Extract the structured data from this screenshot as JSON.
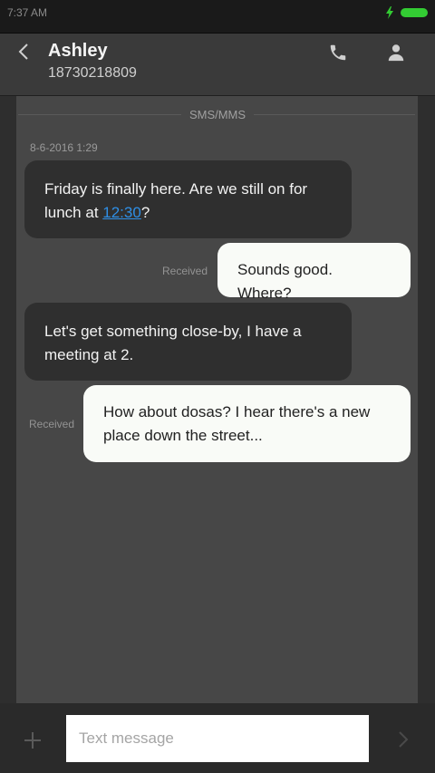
{
  "status_bar": {
    "time": "7:37 AM",
    "icons": [
      "charging-bolt-icon",
      "battery-icon"
    ],
    "battery_color": "#33cc33"
  },
  "header": {
    "contact_name": "Ashley",
    "contact_number": "18730218809",
    "icons": [
      "back-icon",
      "phone-icon",
      "person-icon"
    ]
  },
  "conversation": {
    "channel_label": "SMS/MMS",
    "date": "8-6-2016 1:29",
    "messages": [
      {
        "direction": "incoming",
        "text_before": "Friday is finally here. Are we still on for lunch at ",
        "link": "12:30",
        "text_after": "?"
      },
      {
        "direction": "outgoing",
        "text": "Sounds good. Where?",
        "status": "Received"
      },
      {
        "direction": "incoming",
        "text": "Let's get something close-by, I have a meeting at 2."
      },
      {
        "direction": "outgoing",
        "text": "How about dosas? I hear there's a new place down the street...",
        "status": "Received"
      }
    ]
  },
  "composer": {
    "placeholder": "Text message",
    "value": "",
    "icons": [
      "plus-icon",
      "send-icon"
    ]
  },
  "colors": {
    "incoming_bubble": "#2f2f2f",
    "outgoing_bubble": "#f9fbf7",
    "conversation_bg": "#474747",
    "link": "#2f8fe6"
  }
}
